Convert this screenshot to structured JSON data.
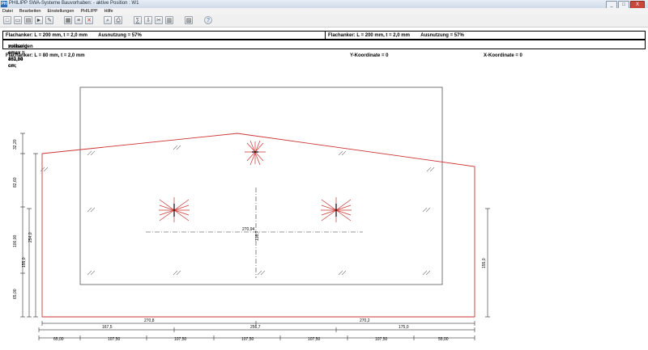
{
  "window": {
    "title": "PHILIPP SWA-Systeme Bauvorhaben: - aktive Position : W1",
    "app_icon_text": "PH",
    "buttons": {
      "minimize": "_",
      "maximize": "□",
      "close": "X"
    }
  },
  "menu": [
    "Datei",
    "Bearbeiten",
    "Einstellungen",
    "PHILIPP",
    "Hilfe"
  ],
  "toolbar_icons": [
    "new-icon",
    "open-icon",
    "save-icon",
    "export-icon",
    "edit-icon",
    "calculator-icon",
    "list-icon",
    "delete-icon",
    "zoom-icon",
    "print-icon",
    "calc-icon",
    "import-icon",
    "tools-icon",
    "database-icon",
    "chart-icon",
    "help-icon"
  ],
  "info": {
    "left": {
      "anchor": "Flachanker: L = 200 mm, t = 2,0 mm",
      "usage": "Ausnutzung = 57%"
    },
    "right": {
      "anchor": "Flachanker: L = 200 mm, t = 2,0 mm",
      "usage": "Ausnutzung = 57%"
    },
    "row2": {
      "present": "vorhanden emax = 103,34 cm;",
      "allowed": "zulässig emax = 462,00 cm"
    }
  },
  "status": {
    "anchor": "Flachanker: L = 80 mm, t = 2,0 mm",
    "y_coord": "Y-Koordinate = 0",
    "x_coord": "X-Koordinate = 0"
  },
  "drawing": {
    "outline_color": "#cc3333",
    "center_x_label": "270,94",
    "center_y_label": "138,7",
    "left_dims": [
      "32,20",
      "82,60",
      "100,00",
      "254,0",
      "155,0",
      "65,00"
    ],
    "right_dim": "155,0",
    "bottom_row1": [
      "270,8",
      "270,2"
    ],
    "bottom_row2": [
      "167,5",
      "256,7",
      "175,0"
    ],
    "bottom_row3": [
      "65,00",
      "107,50",
      "107,50",
      "107,50",
      "107,50",
      "107,50",
      "55,00"
    ]
  }
}
